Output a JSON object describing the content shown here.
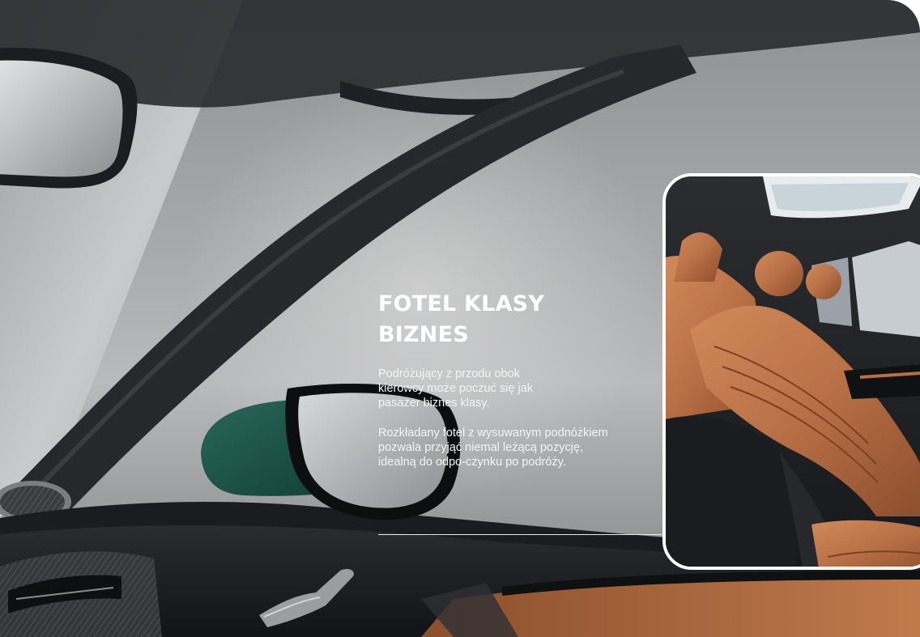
{
  "feature": {
    "title": "FOTEL KLASY BIZNES",
    "paragraph_1": "Podróżujący  z przodu obok kierowcy może poczuć się jak pasażer biznes klasy.",
    "paragraph_2": "Rozkładany fotel z wysuwanym podnóżkiem pozwala przyjąć niemal leżącą pozycję, idealną do odpo-czynku po podróży."
  },
  "colors": {
    "text": "#ffffff",
    "leather": "#b86f45",
    "frame": "#ffffff",
    "accent_trim": "#1f5a4f"
  },
  "images": {
    "hero": "car interior – windshield, A-pillar, side mirror, door panel",
    "thumbnail": "rear cabin with tan leather seats and panoramic sunroof"
  }
}
